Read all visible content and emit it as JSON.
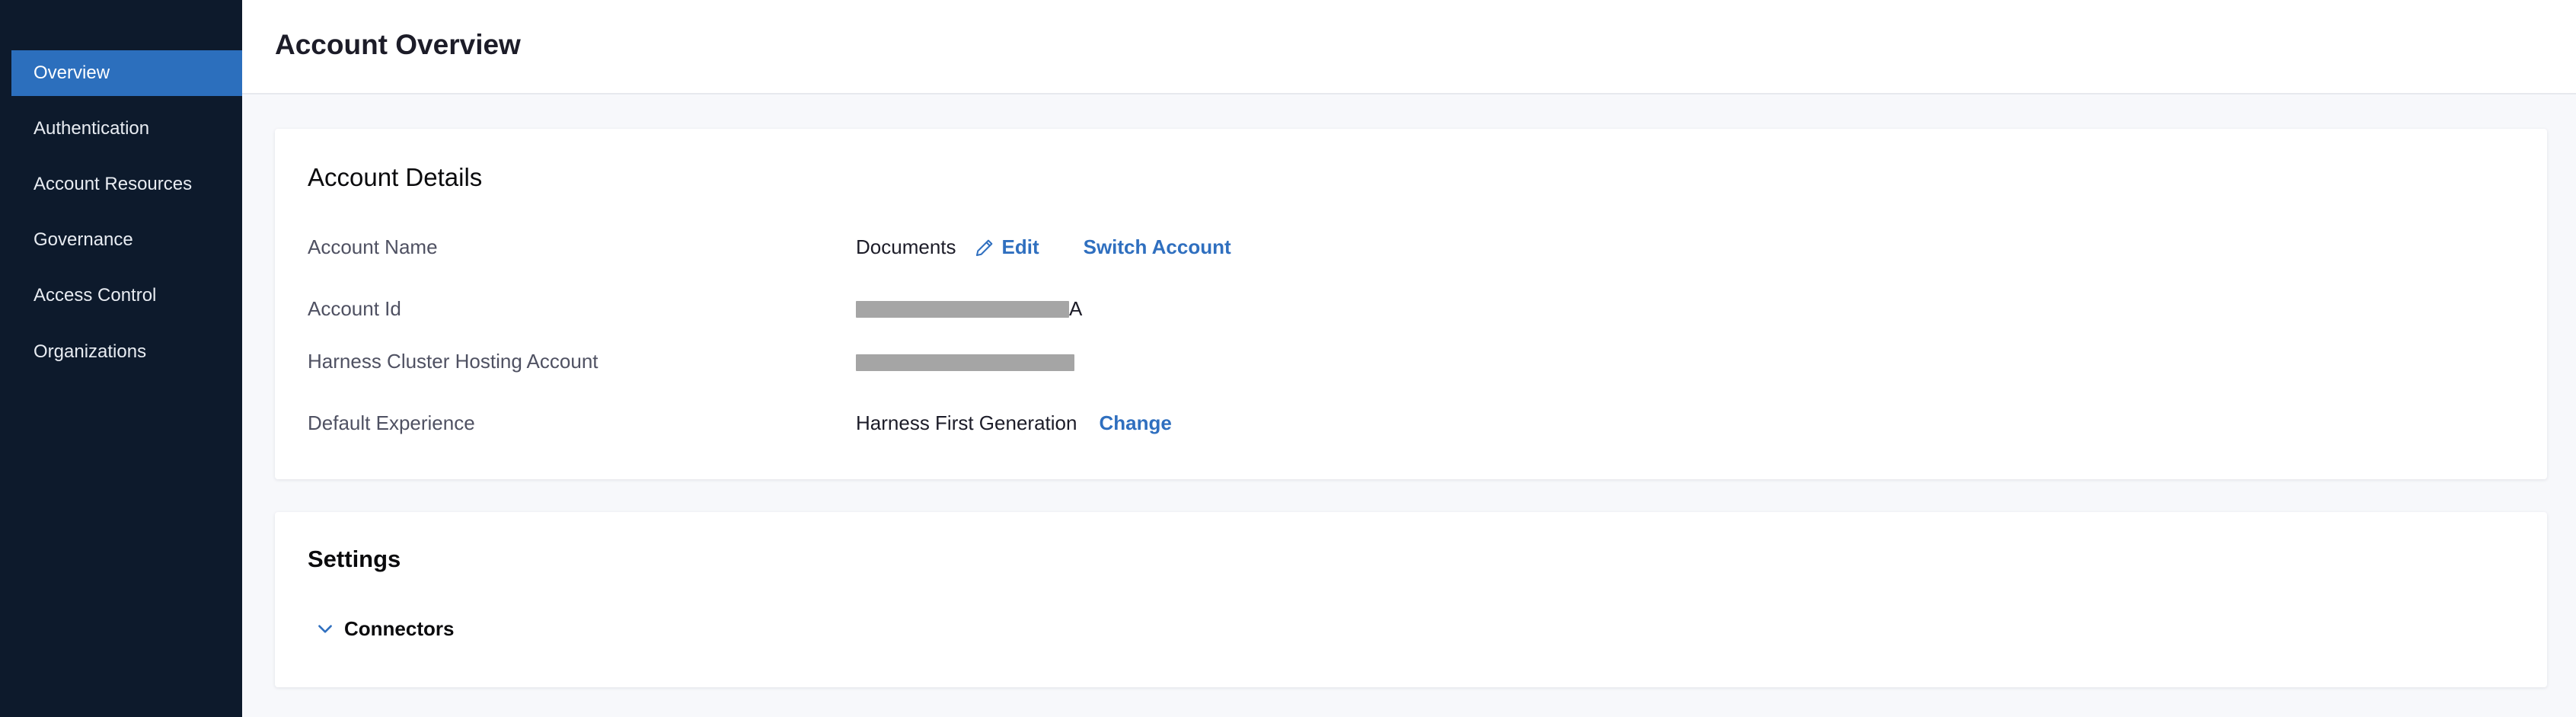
{
  "sidebar": {
    "items": [
      {
        "label": "Overview",
        "active": true
      },
      {
        "label": "Authentication"
      },
      {
        "label": "Account Resources"
      },
      {
        "label": "Governance"
      },
      {
        "label": "Access Control"
      },
      {
        "label": "Organizations"
      }
    ]
  },
  "header": {
    "title": "Account Overview"
  },
  "account_details": {
    "title": "Account Details",
    "account_name_label": "Account Name",
    "account_name_value": "Documents",
    "edit_label": "Edit",
    "switch_account_label": "Switch Account",
    "account_id_label": "Account Id",
    "account_id_visible_tail": "A",
    "cluster_label": "Harness Cluster Hosting Account",
    "default_experience_label": "Default Experience",
    "default_experience_value": "Harness First Generation",
    "change_label": "Change"
  },
  "settings": {
    "title": "Settings",
    "connectors_label": "Connectors"
  },
  "colors": {
    "sidebar_bg": "#0d1a2c",
    "active_item": "#2c6fbd",
    "link": "#2f6fbf"
  },
  "icons": {
    "edit": "pencil-icon",
    "connectors_toggle": "chevron-down-icon"
  }
}
